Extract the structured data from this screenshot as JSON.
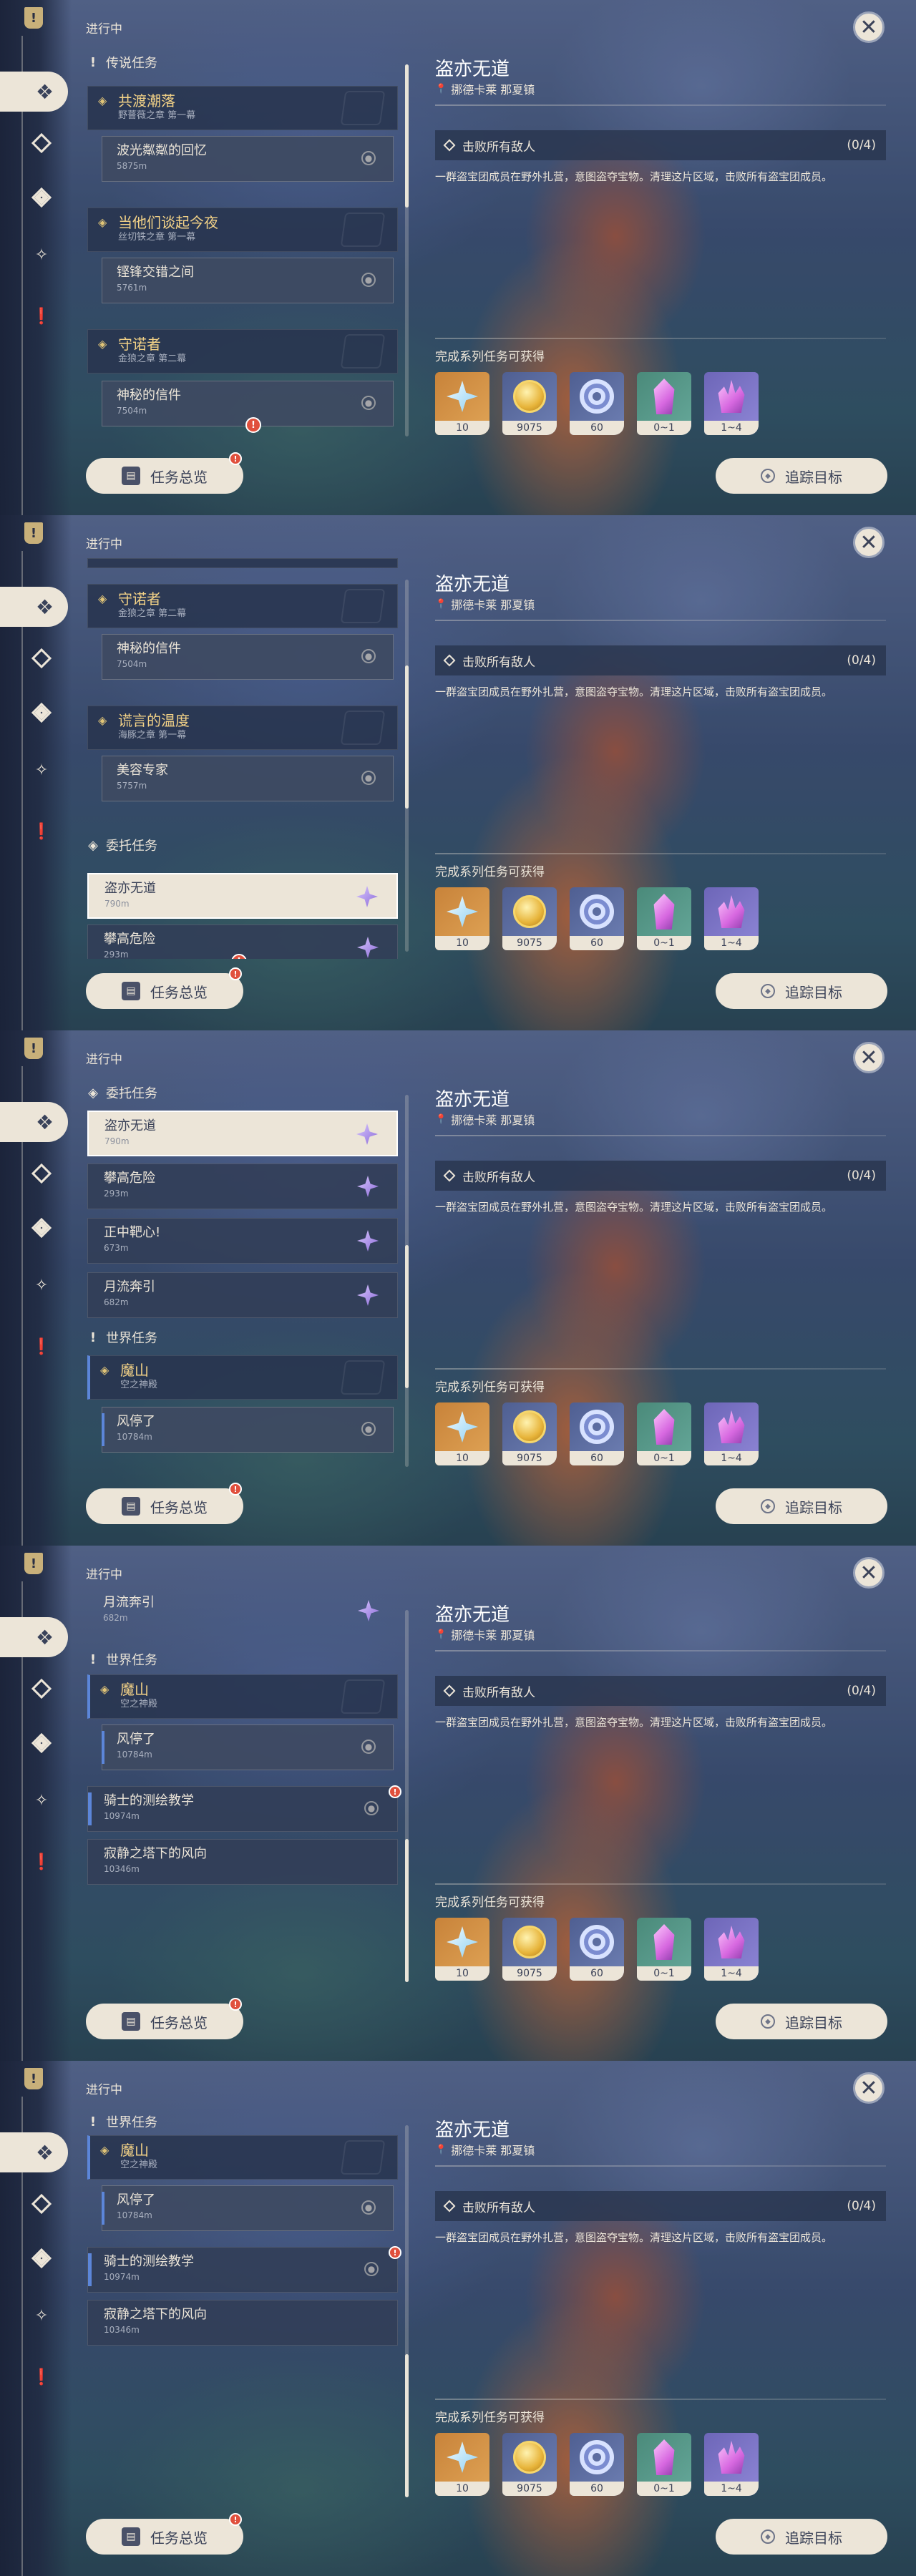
{
  "ui": {
    "in_progress": "进行中",
    "close_symbol": "✕",
    "overview_button": "任务总览",
    "track_button": "追踪目标",
    "red_badge": "!"
  },
  "rail_icons": [
    "quest-book-icon",
    "diamond-quest-icon",
    "diamond-outline-icon",
    "diamond-double-icon",
    "exclamation-icon"
  ],
  "detail": {
    "title": "盗亦无道",
    "location": "挪德卡莱 那夏镇",
    "objective": "击败所有敌人",
    "objective_count": "(0/4)",
    "description": "一群盗宝团成员在野外扎营，意图盗夺宝物。清理这片区域，击败所有盗宝团成员。",
    "rewards_title": "完成系列任务可获得",
    "rewards": [
      {
        "icon": "adventure-exp-icon",
        "qty": "10"
      },
      {
        "icon": "mora-icon",
        "qty": "9075"
      },
      {
        "icon": "companionship-exp-icon",
        "qty": "60"
      },
      {
        "icon": "crystal-chunk-icon",
        "qty": "0~1"
      },
      {
        "icon": "crystal-cluster-icon",
        "qty": "1~4"
      }
    ]
  },
  "sections": {
    "legend": "传说任务",
    "commission": "委托任务",
    "world": "世界任务"
  },
  "quests": {
    "gongdu": {
      "title": "共渡潮落",
      "sub": "野薔薇之章 第一幕"
    },
    "bolin": {
      "title": "波光粼粼的回忆",
      "dist": "5875m"
    },
    "tanqi": {
      "title": "当他们谈起今夜",
      "sub": "丝切铁之章 第一幕"
    },
    "chengcuo": {
      "title": "铿锋交错之间",
      "dist": "5761m"
    },
    "shouno": {
      "title": "守诺者",
      "sub": "金狼之章 第二幕"
    },
    "xinjian": {
      "title": "神秘的信件",
      "dist": "7504m"
    },
    "huangyan": {
      "title": "谎言的温度",
      "sub": "海豚之章 第一幕"
    },
    "meirong": {
      "title": "美容专家",
      "dist": "5757m"
    },
    "daoyi": {
      "title": "盗亦无道",
      "dist": "790m"
    },
    "pangao": {
      "title": "攀高危险",
      "dist": "293m"
    },
    "zhengzhong": {
      "title": "正中靶心!",
      "dist": "673m"
    },
    "yueliu": {
      "title": "月流奔引",
      "dist": "682m"
    },
    "moshan": {
      "title": "魔山",
      "sub": "空之神殿"
    },
    "fengting": {
      "title": "风停了",
      "dist": "10784m"
    },
    "qishi": {
      "title": "骑士的测绘教学",
      "dist": "10974m"
    },
    "jijing": {
      "title": "寂静之塔下的风向",
      "dist": "10346m"
    }
  }
}
